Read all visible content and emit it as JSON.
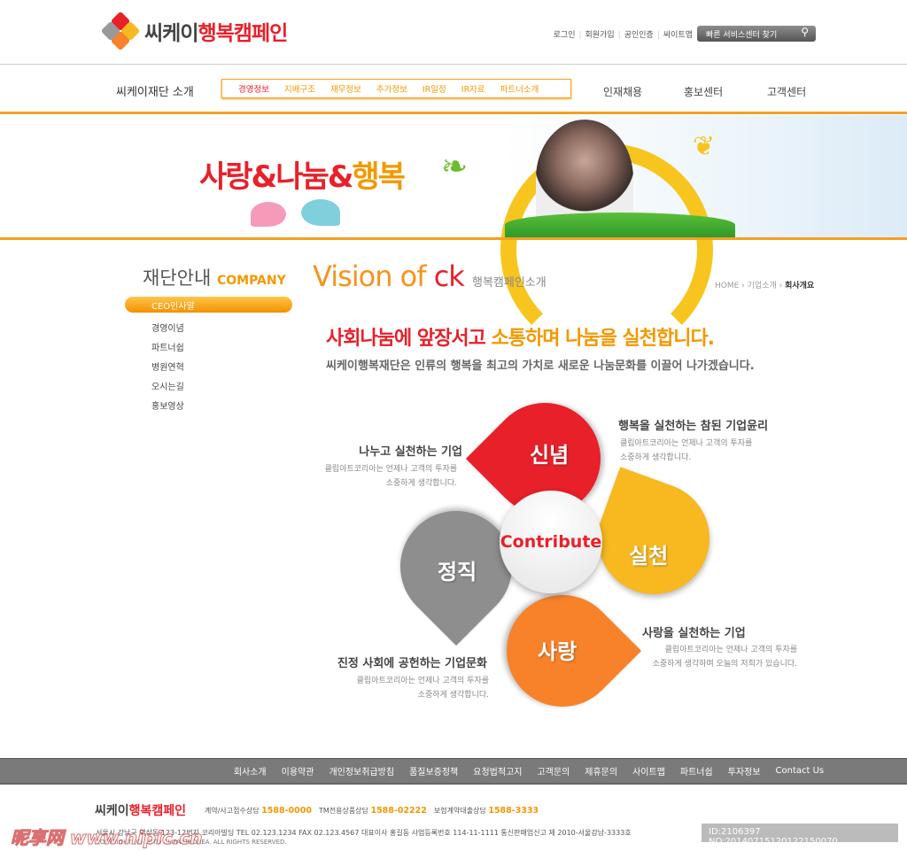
{
  "header": {
    "logo_prefix": "씨케이",
    "logo_suffix": "행복캠페인",
    "top_links": [
      "로그인",
      "회원가입",
      "공인인증",
      "싸이트맵"
    ],
    "service_search": "빠른 서비스센터 찾기"
  },
  "nav": {
    "title": "씨케이재단 소개",
    "sub_items": [
      "경영정보",
      "지배구조",
      "재무정보",
      "추가정보",
      "IR일정",
      "IR자료",
      "파트너소개"
    ],
    "main_items": [
      "인재채용",
      "홍보센터",
      "고객센터"
    ]
  },
  "banner": {
    "slogan_a": "사랑&나눔&",
    "slogan_b": "행복"
  },
  "sidebar": {
    "title": "재단안내",
    "title_en": "COMPANY",
    "active": "CEO인사말",
    "items": [
      "경영이념",
      "파트너쉽",
      "병원연혁",
      "오시는길",
      "홍보영상"
    ]
  },
  "content": {
    "title_a": "Vision of ",
    "title_b": "ck",
    "title_sub": "행복캠페인소개",
    "breadcrumb": [
      "HOME",
      "기업소개",
      "회사개요"
    ],
    "headline_a": "사회나눔에 앞장서고 ",
    "headline_b": "소통하며 나눔을 실천합니다.",
    "subline": "씨케이행복재단은 인류의 행복을 최고의 가치로 새로운 나눔문화를 이끌어 나가겠습니다."
  },
  "diagram": {
    "center": "Contribute",
    "petals": [
      {
        "label": "신념",
        "color": "#e8202a"
      },
      {
        "label": "실천",
        "color": "#f7b820"
      },
      {
        "label": "사랑",
        "color": "#f7822a"
      },
      {
        "label": "정직",
        "color": "#8e8e8e"
      }
    ],
    "notes": [
      {
        "title": "나누고 실천하는 기업",
        "desc1": "클립아트코리아는 언제나 고객의 투자를",
        "desc2": "소중하게 생각합니다."
      },
      {
        "title": "행복을 실천하는 참된 기업윤리",
        "desc1": "클립아트코리아는 언제나 고객의 투자를",
        "desc2": "소중하게 생각합니다."
      },
      {
        "title": "사랑을 실천하는 기업",
        "desc1": "클립아트코리아는 언제나 고객의 투자를",
        "desc2": "소중하게 생각하며 오늘의 저희가 있습니다."
      },
      {
        "title": "진정 사회에 공헌하는 기업문화",
        "desc1": "클립아트코리아는 언제나 고객의 투자를",
        "desc2": "소중하게 생각합니다."
      }
    ]
  },
  "footer": {
    "links": [
      "회사소개",
      "이용약관",
      "개인정보취급방침",
      "품질보증정책",
      "요청법적고지",
      "고객문의",
      "제휴문의",
      "사이트맵",
      "파트너쉽",
      "투자정보",
      "Contact Us"
    ],
    "logo_prefix": "씨케이",
    "logo_suffix": "행복캠페인",
    "tel": [
      {
        "label": "계약/사고접수상담",
        "num": "1588-0000"
      },
      {
        "label": "TM전용상품상담",
        "num": "1588-02222"
      },
      {
        "label": "보험계약대출상담",
        "num": "1588-3333"
      }
    ],
    "address": "서울시 강남구 역삼동 123-12번지 코리아빌딩  TEL 02.123.1234   FAX 02.123.4567   대표이사 홍길동 사업등록번호 114-11-1111 통신판매업신고 제 2010-서울강남-3333호",
    "copyright": "COPYRIGHT (C) LOTO CLIPARTKOREA. ALL RIGHTS RESERVED."
  },
  "watermark": {
    "site": "昵享网 www.nipic.cn",
    "id": "ID:2106397 NO:20140715120122150070"
  }
}
